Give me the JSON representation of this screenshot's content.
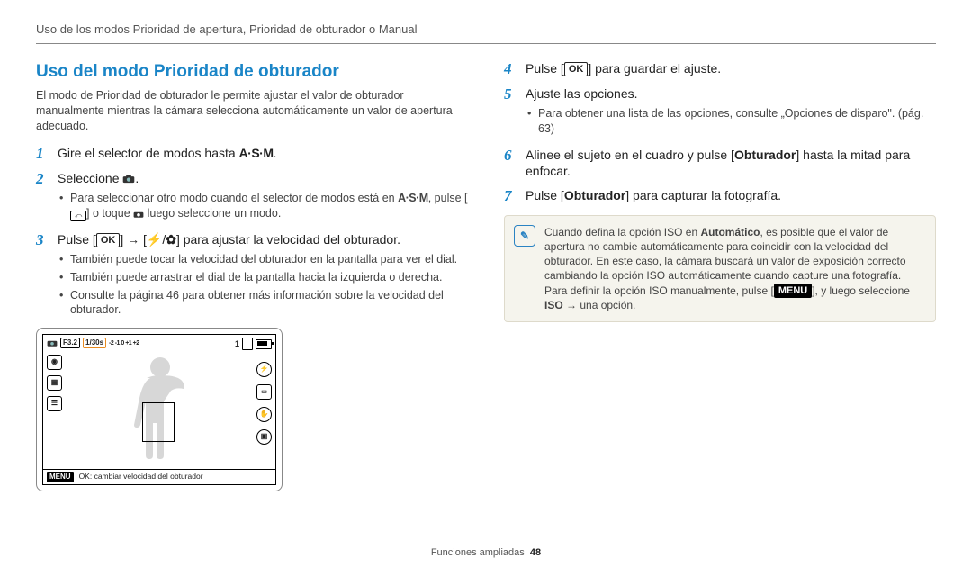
{
  "header": "Uso de los modos Prioridad de apertura, Prioridad de obturador o Manual",
  "section_title": "Uso del modo Prioridad de obturador",
  "intro": "El modo de Prioridad de obturador le permite ajustar el valor de obturador manualmente mientras la cámara selecciona automáticamente un valor de apertura adecuado.",
  "left_steps": {
    "s1_a": "Gire el selector de modos hasta ",
    "s1_icon": "A·S·M",
    "s1_b": ".",
    "s2_a": "Seleccione ",
    "s2_b": ".",
    "s2_sub1_a": "Para seleccionar otro modo cuando el selector de modos está en ",
    "s2_sub1_b": ", pulse [",
    "s2_sub1_c": "] o toque ",
    "s2_sub1_d": " luego seleccione un modo.",
    "s3_a": "Pulse [",
    "s3_ok": "OK",
    "s3_b": "] → [",
    "s3_c": "/",
    "s3_d": "] para ajustar la velocidad del obturador.",
    "s3_sub1": "También puede tocar la velocidad del obturador en la pantalla para ver el dial.",
    "s3_sub2": "También puede arrastrar el dial de la pantalla hacia la izquierda o derecha.",
    "s3_sub3": "Consulte la página 46 para obtener más información sobre la velocidad del obturador."
  },
  "right_steps": {
    "s4_a": "Pulse [",
    "s4_ok": "OK",
    "s4_b": "] para guardar el ajuste.",
    "s5": "Ajuste las opciones.",
    "s5_sub1": "Para obtener una lista de las opciones, consulte „Opciones de disparo\". (pág. 63)",
    "s6_a": "Alinee el sujeto en el cuadro y pulse [",
    "s6_bold": "Obturador",
    "s6_b": "] hasta la mitad para enfocar.",
    "s7_a": "Pulse [",
    "s7_bold": "Obturador",
    "s7_b": "] para capturar la fotografía."
  },
  "note": {
    "a": "Cuando defina la opción ISO en ",
    "auto": "Automático",
    "b": ", es posible que el valor de apertura no cambie automáticamente para coincidir con la velocidad del obturador. En este caso, la cámara buscará un valor de exposición correcto cambiando la opción ISO automáticamente cuando capture una fotografía. Para definir la opción ISO manualmente, pulse [",
    "menu": "MENU",
    "c": "], y luego seleccione ",
    "iso": "ISO",
    "d": " → una opción."
  },
  "lcd": {
    "f": "F3.2",
    "shutter": "1/30s",
    "ev": "-2 -1 0 +1 +2",
    "count": "1",
    "menu": "MENU",
    "menu_text": "OK: cambiar velocidad del obturador"
  },
  "footer_label": "Funciones ampliadas",
  "footer_page": "48"
}
